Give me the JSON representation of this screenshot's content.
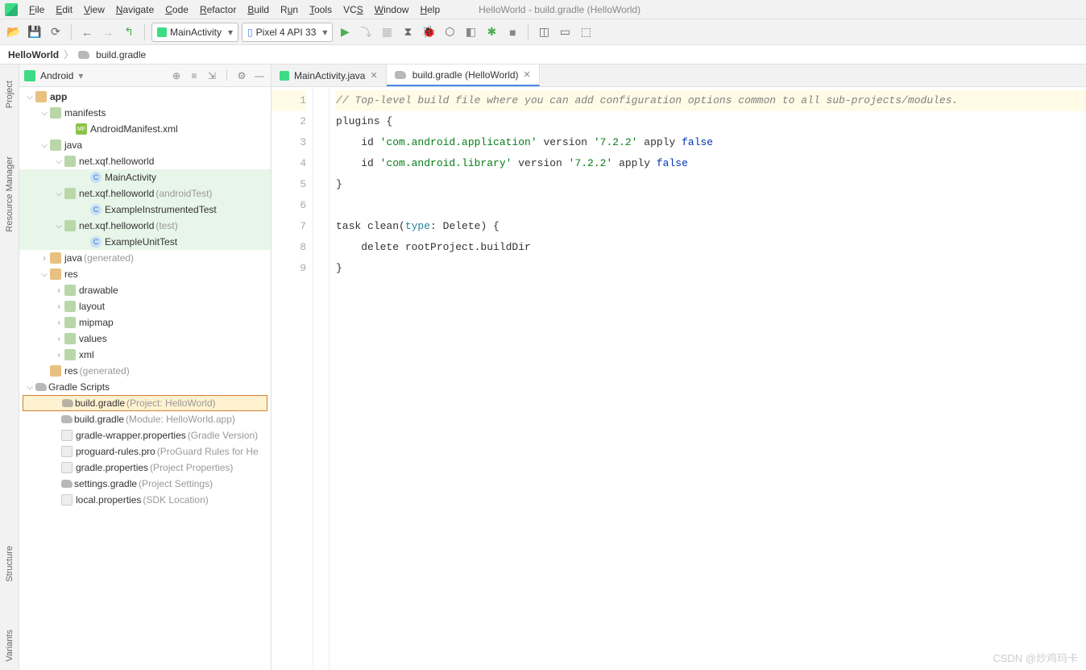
{
  "menu": {
    "items": [
      "File",
      "Edit",
      "View",
      "Navigate",
      "Code",
      "Refactor",
      "Build",
      "Run",
      "Tools",
      "VCS",
      "Window",
      "Help"
    ],
    "title": "HelloWorld - build.gradle (HelloWorld)"
  },
  "toolbar": {
    "config": "MainActivity",
    "device": "Pixel 4 API 33"
  },
  "breadcrumb": {
    "project": "HelloWorld",
    "file": "build.gradle"
  },
  "gutters": {
    "project": "Project",
    "resourceManager": "Resource Manager",
    "structure": "Structure",
    "variants": "Variants"
  },
  "projectPanel": {
    "title": "Android"
  },
  "tree": {
    "app": "app",
    "manifests": "manifests",
    "androidManifest": "AndroidManifest.xml",
    "javaDir": "java",
    "pkg": "net.xqf.helloworld",
    "mainActivity": "MainActivity",
    "pkgAndroidTest": "net.xqf.helloworld",
    "pkgAndroidTestSuffix": "(androidTest)",
    "exampleInstrTest": "ExampleInstrumentedTest",
    "pkgTest": "net.xqf.helloworld",
    "pkgTestSuffix": "(test)",
    "exampleUnitTest": "ExampleUnitTest",
    "javaGen": "java",
    "javaGenSuffix": "(generated)",
    "res": "res",
    "drawable": "drawable",
    "layout": "layout",
    "mipmap": "mipmap",
    "values": "values",
    "xml": "xml",
    "resGen": "res",
    "resGenSuffix": "(generated)",
    "gradleScripts": "Gradle Scripts",
    "buildGradleProj": "build.gradle",
    "buildGradleProjSuffix": "(Project: HelloWorld)",
    "buildGradleMod": "build.gradle",
    "buildGradleModSuffix": "(Module: HelloWorld.app)",
    "gradleWrapper": "gradle-wrapper.properties",
    "gradleWrapperSuffix": "(Gradle Version)",
    "proguard": "proguard-rules.pro",
    "proguardSuffix": "(ProGuard Rules for He",
    "gradleProps": "gradle.properties",
    "gradlePropsSuffix": "(Project Properties)",
    "settingsGradle": "settings.gradle",
    "settingsGradleSuffix": "(Project Settings)",
    "localProps": "local.properties",
    "localPropsSuffix": "(SDK Location)"
  },
  "tabs": {
    "mainActivity": "MainActivity.java",
    "buildGradle": "build.gradle (HelloWorld)"
  },
  "code": {
    "l1_comment": "// Top-level build file where you can add configuration options common to all sub-projects/modules.",
    "l2_plugins": "plugins",
    "l2_brace": " {",
    "l3_id": "    id ",
    "l3_str": "'com.android.application'",
    "l3_version": " version ",
    "l3_ver_str": "'7.2.2'",
    "l3_apply": " apply ",
    "l3_false": "false",
    "l4_id": "    id ",
    "l4_str": "'com.android.library'",
    "l4_version": " version ",
    "l4_ver_str": "'7.2.2'",
    "l4_apply": " apply ",
    "l4_false": "false",
    "l5_brace": "}",
    "l7_task": "task clean(",
    "l7_type": "type",
    "l7_delete": ": Delete) {",
    "l8_body": "    delete rootProject.buildDir",
    "l9_brace": "}"
  },
  "watermark": "CSDN @炒鸡玛卡"
}
